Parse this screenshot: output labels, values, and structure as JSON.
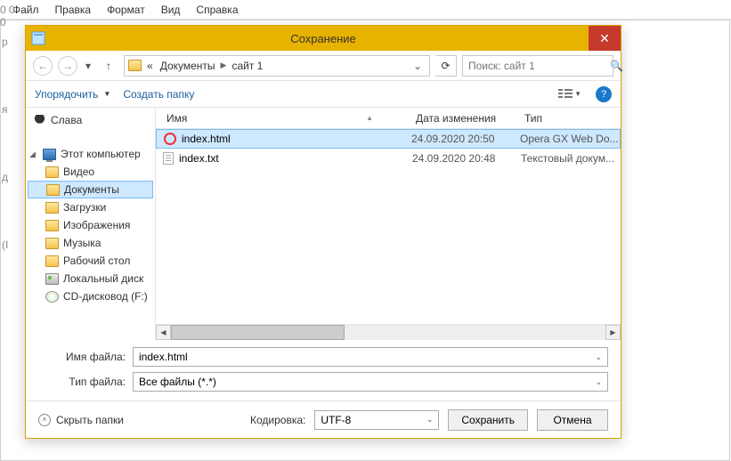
{
  "menubar": [
    "Файл",
    "Правка",
    "Формат",
    "Вид",
    "Справка"
  ],
  "bg_lines": [
    "р",
    "я",
    "д",
    "(I",
    "0 0 0"
  ],
  "dialog": {
    "title": "Сохранение",
    "breadcrumb_prefix": "«",
    "breadcrumbs": [
      "Документы",
      "сайт 1"
    ],
    "search_placeholder": "Поиск: сайт 1",
    "toolbar": {
      "organize": "Упорядочить",
      "newfolder": "Создать папку"
    },
    "sidebar": {
      "user": "Слава",
      "computer": "Этот компьютер",
      "items": [
        "Видео",
        "Документы",
        "Загрузки",
        "Изображения",
        "Музыка",
        "Рабочий стол"
      ],
      "drive": "Локальный диск",
      "cd": "CD-дисковод (F:)"
    },
    "columns": {
      "name": "Имя",
      "date": "Дата изменения",
      "type": "Тип"
    },
    "files": [
      {
        "icon": "opera",
        "name": "index.html",
        "date": "24.09.2020 20:50",
        "type": "Opera GX Web Do...",
        "selected": true
      },
      {
        "icon": "txt",
        "name": "index.txt",
        "date": "24.09.2020 20:48",
        "type": "Текстовый докум...",
        "selected": false
      }
    ],
    "filename_label": "Имя файла:",
    "filename_value": "index.html",
    "filetype_label": "Тип файла:",
    "filetype_value": "Все файлы  (*.*)",
    "hide_folders": "Скрыть папки",
    "encoding_label": "Кодировка:",
    "encoding_value": "UTF-8",
    "save": "Сохранить",
    "cancel": "Отмена"
  }
}
